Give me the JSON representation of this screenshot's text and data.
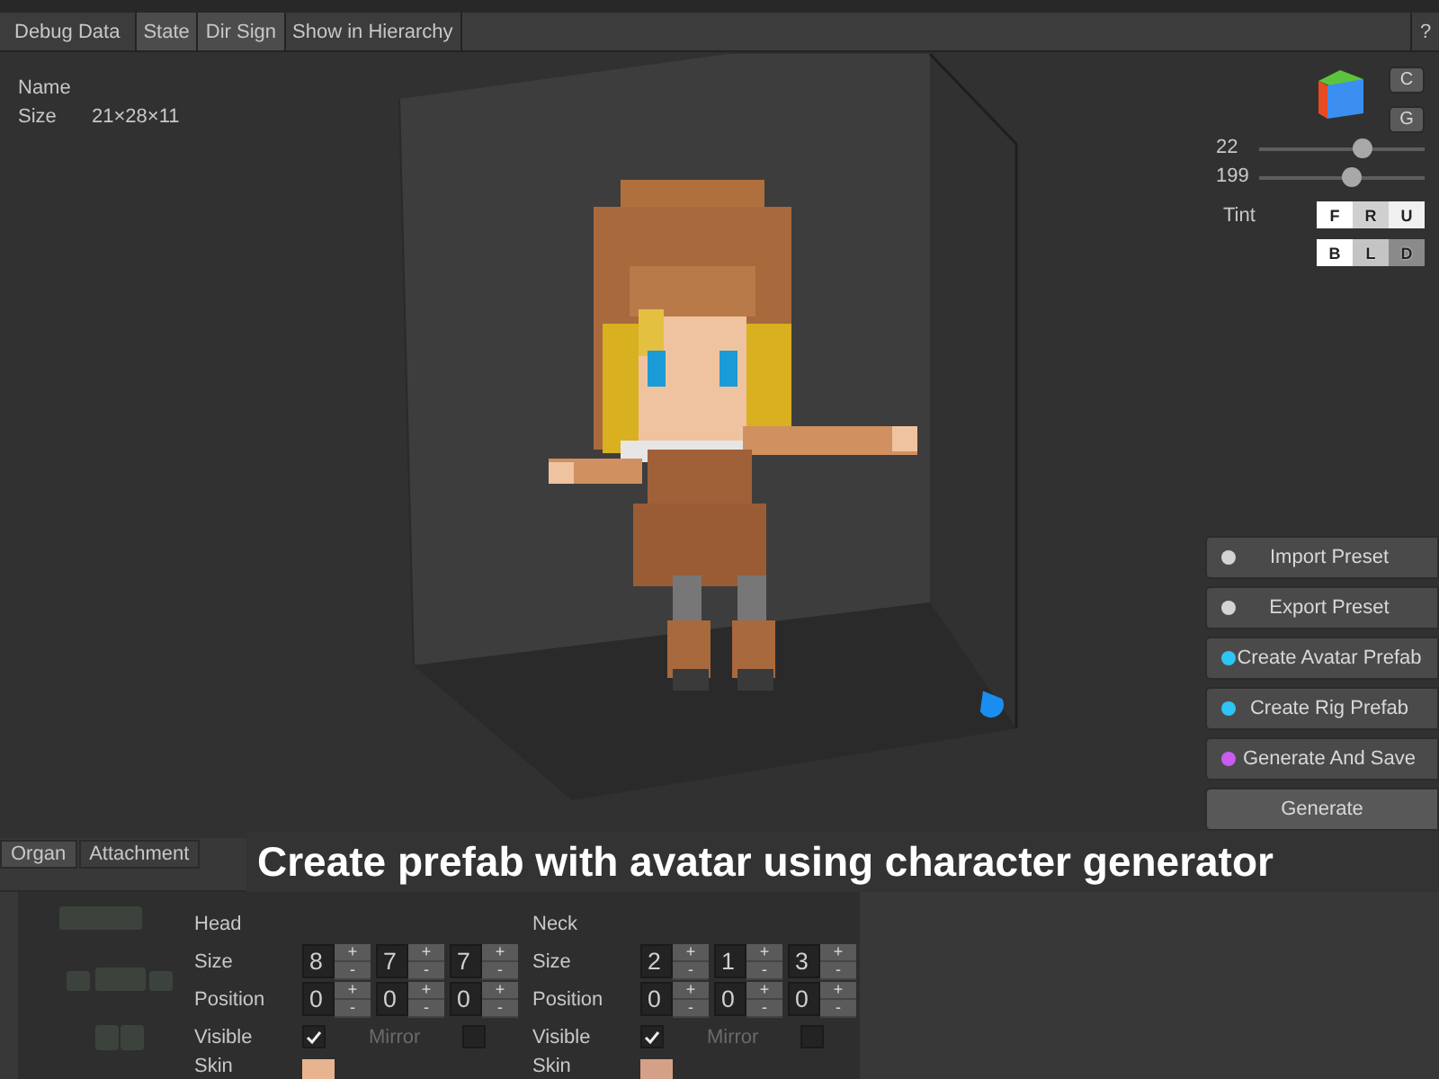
{
  "toolbar": [
    {
      "label": "Debug Data",
      "on": false
    },
    {
      "label": "State",
      "on": true
    },
    {
      "label": "Dir Sign",
      "on": true
    },
    {
      "label": "Show in Hierarchy",
      "on": false
    }
  ],
  "help": "?",
  "info": {
    "name_label": "Name",
    "size_label": "Size",
    "size_value": "21×28×11"
  },
  "view_controls": {
    "buttons": [
      "C",
      "G"
    ],
    "sliders": [
      {
        "reading": "22",
        "level": 0.62
      },
      {
        "reading": "199",
        "level": 0.55
      }
    ],
    "tint_label": "Tint",
    "tint": [
      {
        "label": "F",
        "color": "#ffffff"
      },
      {
        "label": "R",
        "color": "#d0d0d0"
      },
      {
        "label": "U",
        "color": "#f0f0f0"
      },
      {
        "label": "B",
        "color": "#ffffff"
      },
      {
        "label": "L",
        "color": "#c4c4c4"
      },
      {
        "label": "D",
        "color": "#8a8a8a"
      }
    ]
  },
  "actions": [
    {
      "label": "Import Preset",
      "color": "#d4d4d4"
    },
    {
      "label": "Export Preset",
      "color": "#d4d4d4"
    },
    {
      "label": "Create Avatar Prefab",
      "color": "#2ec5f5"
    },
    {
      "label": "Create Rig Prefab",
      "color": "#2ec5f5"
    },
    {
      "label": "Generate And Save",
      "color": "#c85cf0"
    }
  ],
  "generate": "Generate",
  "bottom_tabs": [
    {
      "label": "Organ",
      "selected": true
    },
    {
      "label": "Attachment",
      "selected": false
    }
  ],
  "caption": "Create prefab with avatar using character generator",
  "parts": [
    {
      "name": "Head",
      "size_label": "Size",
      "size": [
        {
          "value": "8",
          "up": "+",
          "down": "-"
        },
        {
          "value": "7",
          "up": "+",
          "down": "-"
        },
        {
          "value": "7",
          "up": "+",
          "down": "-"
        }
      ],
      "position_label": "Position",
      "position": [
        {
          "value": "0",
          "up": "+",
          "down": "-"
        },
        {
          "value": "0",
          "up": "+",
          "down": "-"
        },
        {
          "value": "0",
          "up": "+",
          "down": "-"
        }
      ],
      "visible_label": "Visible",
      "visible": true,
      "mirror_label": "Mirror",
      "mirror": false,
      "mirror_disabled": true,
      "skin": {
        "label": "Skin",
        "color": "#e8b490"
      }
    },
    {
      "name": "Neck",
      "size_label": "Size",
      "size": [
        {
          "value": "2",
          "up": "+",
          "down": "-"
        },
        {
          "value": "1",
          "up": "+",
          "down": "-"
        },
        {
          "value": "3",
          "up": "+",
          "down": "-"
        }
      ],
      "position_label": "Position",
      "position": [
        {
          "value": "0",
          "up": "+",
          "down": "-"
        },
        {
          "value": "0",
          "up": "+",
          "down": "-"
        },
        {
          "value": "0",
          "up": "+",
          "down": "-"
        }
      ],
      "visible_label": "Visible",
      "visible": true,
      "mirror_label": "Mirror",
      "mirror": false,
      "mirror_disabled": true,
      "skin": {
        "label": "Skin",
        "color": "#d4a088"
      }
    }
  ]
}
